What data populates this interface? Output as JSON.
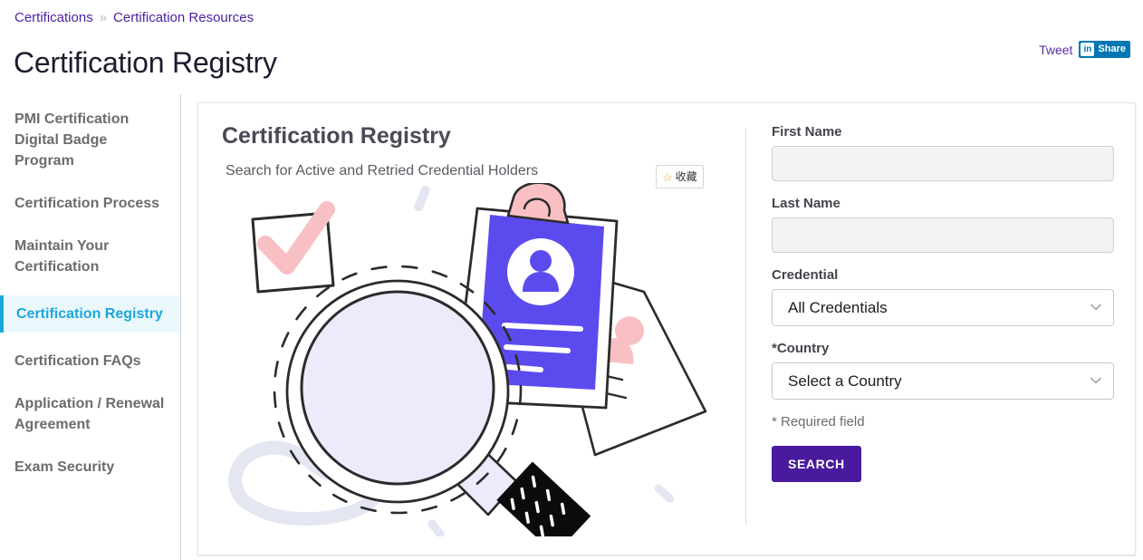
{
  "breadcrumb": {
    "items": [
      {
        "label": "Certifications"
      },
      {
        "label": "Certification Resources"
      }
    ],
    "separator": "»"
  },
  "header": {
    "title": "Certification Registry"
  },
  "social": {
    "tweet_label": "Tweet",
    "linkedin_badge": "in",
    "linkedin_label": "Share",
    "linkedin_color": "#0077B5",
    "tweet_color": "#5b2fa3"
  },
  "sidebar": {
    "items": [
      {
        "label": "PMI Certification Digital Badge Program",
        "active": false
      },
      {
        "label": "Certification Process",
        "active": false
      },
      {
        "label": "Maintain Your Certification",
        "active": false
      },
      {
        "label": "Certification Registry",
        "active": true
      },
      {
        "label": "Certification FAQs",
        "active": false
      },
      {
        "label": "Application / Renewal Agreement",
        "active": false
      },
      {
        "label": "Exam Security",
        "active": false
      }
    ],
    "active_color": "#1BA7DB",
    "active_background": "#EAF8FC",
    "inactive_color": "#6c6c6c"
  },
  "card": {
    "title": "Certification Registry",
    "subtitle": "Search for Active and Retried Credential Holders",
    "favorite": {
      "label": "收藏",
      "icon": "star-icon",
      "star_color": "#F5A623"
    }
  },
  "illustration": {
    "name": "magnifying-glass-credential-search-illustration",
    "colors": {
      "lens": "#ECEAFB",
      "card_purple": "#5B4BEE",
      "accent_pink": "#F9C0C4",
      "handle_black": "#0b0b0b",
      "decor_lavender": "#E4E6F2"
    }
  },
  "form": {
    "first_name": {
      "label": "First Name",
      "value": "",
      "placeholder": ""
    },
    "last_name": {
      "label": "Last Name",
      "value": "",
      "placeholder": ""
    },
    "credential": {
      "label": "Credential",
      "selected": "All Credentials"
    },
    "country": {
      "label": "*Country",
      "selected": "Select a Country"
    },
    "required_note": "* Required field",
    "search_button": {
      "label": "SEARCH",
      "color": "#4A1A9E"
    }
  }
}
